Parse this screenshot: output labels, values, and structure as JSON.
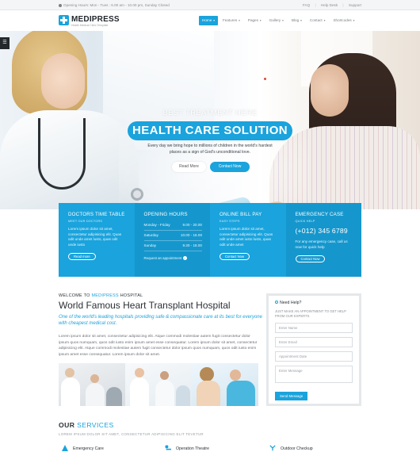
{
  "topbar": {
    "hours": "Opening Hours: Mon - Tues : 6.00 am - 10.00 pm, Sunday Closed",
    "links": [
      "FAQ",
      "Help Desk",
      "Support"
    ]
  },
  "header": {
    "logo_name": "MEDIPRESS",
    "logo_tagline": "Health Medical Clinic Template",
    "nav": [
      {
        "label": "Home",
        "active": true
      },
      {
        "label": "Features",
        "active": false
      },
      {
        "label": "Pages",
        "active": false
      },
      {
        "label": "Gallery",
        "active": false
      },
      {
        "label": "Blog",
        "active": false
      },
      {
        "label": "Contact",
        "active": false
      },
      {
        "label": "Shortcodes",
        "active": false
      }
    ]
  },
  "hero": {
    "subtitle": "BEST TREATMENT HERE",
    "title": "HEALTH CARE SOLUTION",
    "text": "Every day we bring hope to millions of children in the world's hardest places as a sign of God's unconditional love.",
    "read_more": "Read More",
    "contact_now": "Contact Now"
  },
  "info": {
    "doctors": {
      "title": "DOCTORS TIME TABLE",
      "small": "MEET OUR DOCTORS",
      "text": "Lorem ipsum dolor sit amet, consectetur adipisicing elit. Quas odit unde amet lusto, quas odit unde iusto",
      "button": "Read more"
    },
    "hours": {
      "title": "OPENING HOURS",
      "rows": [
        {
          "day": "Monday - Friday",
          "time": "9.00 - 20.00"
        },
        {
          "day": "Saturday",
          "time": "10.00 - 16.00"
        },
        {
          "day": "Sunday",
          "time": "9.30 - 18.00"
        }
      ],
      "note": "Request an appointment"
    },
    "bill": {
      "title": "ONLINE BILL PAY",
      "small": "EASY STEPS",
      "text": "Lorem ipsum dolor sit amet, consectetur adipisicing elit. Quas odit unde amet iusto lusto, quas odit unde amet",
      "button": "Contact Now"
    },
    "emergency": {
      "title": "EMERGENCY CASE",
      "small": "QUICK HELP",
      "phone": "(+012) 345 6789",
      "text": "For any emergency case, call us now for quick help",
      "button": "Contact Now"
    }
  },
  "welcome": {
    "label_prefix": "WELCOME TO",
    "brand": "MEDIPRESS",
    "label_suffix": "HOSPITAL",
    "headline": "World Famous Heart Transplant Hospital",
    "lead": "One of the world's leading hospitals providing safe & compassionate care at its best for everyone with cheapest medical cost.",
    "body": "Lorem ipsum dolor sit amet, consectetur adipisicing elit. Atque commodi molestiae autem fugit consectetur dolor ipsum quos numquam, quos odit iusto enim ipsum amet esse consequatur. Lorem ipsum dolor sit amet, consectetur adipisicing elit. Atque commodi molestiae autem fugit consectetur dolor ipsum quos numquam, quos odit iusto enim ipsum amet esse consequatur. Lorem ipsum dolor sit amet."
  },
  "form": {
    "title": "Need Help?",
    "subtitle": "JUST MAKE AN APPOINTMENT TO GET HELP FROM OUR EXPERTS",
    "name_placeholder": "Enter Name",
    "email_placeholder": "Enter Email",
    "date_placeholder": "Appointment Date",
    "message_placeholder": "Enter Message",
    "send": "Send Message"
  },
  "services": {
    "title_a": "OUR",
    "title_b": "SERVICES",
    "subtitle": "LOREM IPSUM DOLOR SIT AMET, CONSECTETUR ADIPISICING ELIT TEVETUR",
    "items": [
      "Emergency Care",
      "Operation Theatre",
      "Outdoor Checkup"
    ]
  },
  "colors": {
    "accent": "#1aa3dc",
    "dark": "#2b3035"
  }
}
